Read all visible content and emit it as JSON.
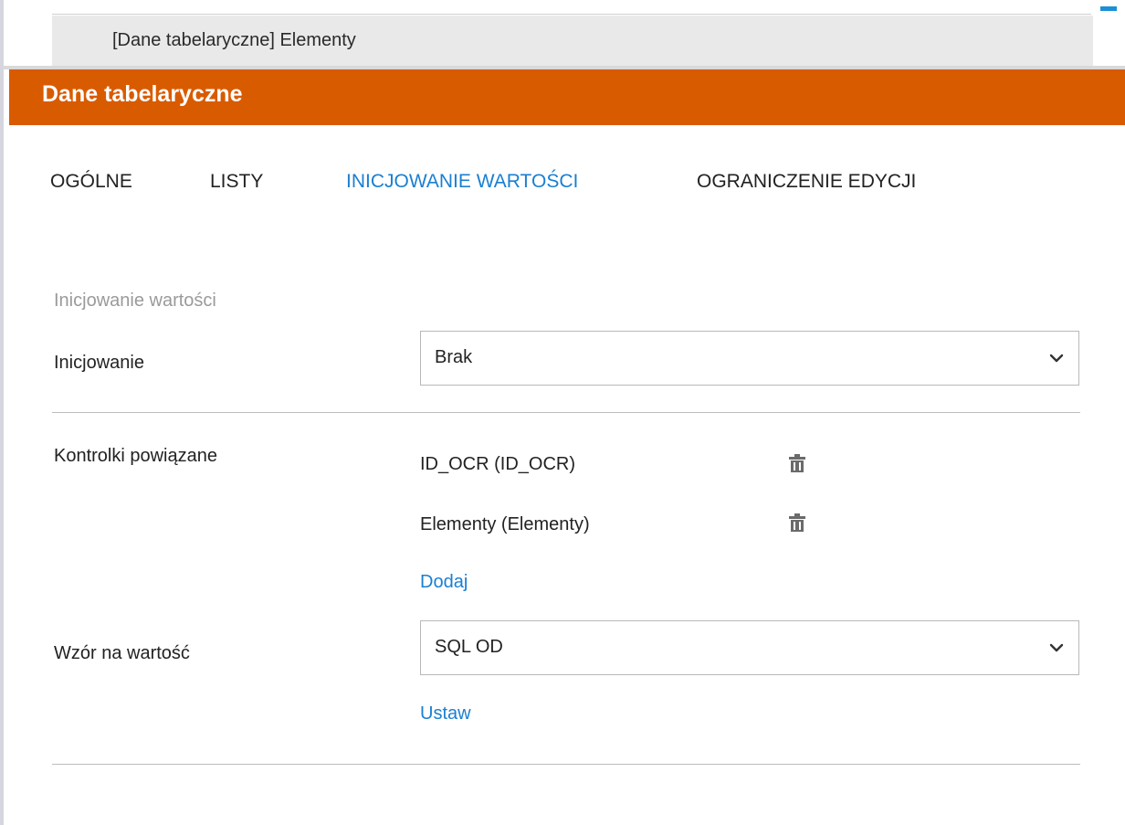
{
  "breadcrumb": {
    "text": "[Dane tabelaryczne] Elementy"
  },
  "header": {
    "title": "Dane tabelaryczne"
  },
  "tabs": [
    {
      "label": "OGÓLNE",
      "active": false
    },
    {
      "label": "LISTY",
      "active": false
    },
    {
      "label": "INICJOWANIE WARTOŚCI",
      "active": true
    },
    {
      "label": "OGRANICZENIE EDYCJI",
      "active": false
    }
  ],
  "section": {
    "heading": "Inicjowanie wartości",
    "initialization": {
      "label": "Inicjowanie",
      "value": "Brak"
    },
    "linked_controls": {
      "label": "Kontrolki powiązane",
      "items": [
        {
          "name": "ID_OCR (ID_OCR)",
          "delete_icon": "trash-icon"
        },
        {
          "name": "Elementy (Elementy)",
          "delete_icon": "trash-icon"
        }
      ],
      "add_label": "Dodaj"
    },
    "formula": {
      "label": "Wzór na wartość",
      "value": "SQL OD",
      "set_label": "Ustaw"
    }
  },
  "colors": {
    "header_bg": "#d95b00",
    "accent": "#1a7fd1",
    "corner_accent": "#1c8fd6"
  }
}
